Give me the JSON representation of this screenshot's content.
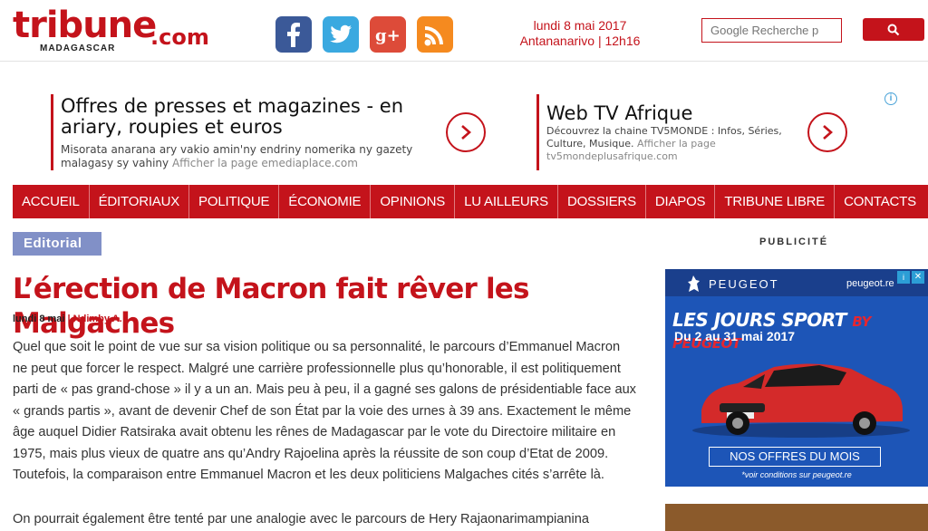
{
  "header": {
    "logo_main": "tribune",
    "logo_domain": ".com",
    "logo_country": "MADAGASCAR",
    "date": "lundi 8 mai 2017",
    "location_time": "Antananarivo | 12h16",
    "search_placeholder": "Google Recherche p",
    "social": [
      "facebook-icon",
      "twitter-icon",
      "google-plus-icon",
      "rss-icon"
    ],
    "accent": "#c4131b"
  },
  "ads": [
    {
      "title": "Offres de presses et magazines - en ariary, roupies et euros",
      "desc": "Misorata anarana ary vakio amin'ny endriny nomerika ny gazety malagasy sy vahiny",
      "link": "Afficher la page emediaplace.com"
    },
    {
      "title": "Web TV Afrique",
      "desc": "Découvrez la chaine TV5MONDE : Infos, Séries, Culture, Musique.",
      "link": "Afficher la page tv5mondeplusafrique.com"
    }
  ],
  "nav": [
    "ACCUEIL",
    "ÉDITORIAUX",
    "POLITIQUE",
    "ÉCONOMIE",
    "OPINIONS",
    "LU AILLEURS",
    "DOSSIERS",
    "DIAPOS",
    "TRIBUNE LIBRE",
    "CONTACTS"
  ],
  "article": {
    "category": "Editorial",
    "title": "L’érection de Macron fait rêver les Malgaches",
    "date": "lundi 8 mai",
    "author": "Ndimby A.",
    "paragraphs": [
      "Quel que soit le point de vue sur sa vision politique ou sa personnalité, le parcours d’Emmanuel Macron ne peut que forcer le respect. Malgré une carrière professionnelle plus qu’honorable, il est politiquement parti de « pas grand-chose » il y a un an. Mais peu à peu, il a gagné ses galons de présidentiable face aux « grands partis », avant de devenir Chef de son État par la voie des urnes à 39 ans. Exactement le même âge auquel Didier Ratsiraka avait obtenu les rênes de Madagascar par le vote du Directoire militaire en 1975, mais plus vieux de quatre ans qu’Andry Rajoelina après la réussite de son coup d’Etat de 2009. Toutefois, la comparaison entre Emmanuel Macron et les deux politiciens Malgaches cités s’arrête là.",
      "On pourrait également être tenté par une analogie avec le parcours de Hery Rajaonarimampianina"
    ]
  },
  "sidebar": {
    "label": "PUBLICITÉ",
    "ad": {
      "brand": "PEUGEOT",
      "url": "peugeot.re",
      "headline": "LES JOURS SPORT",
      "headline_by": "BY PEUGEOT",
      "dates": "Du 2 au 31 mai 2017",
      "cta": "NOS OFFRES DU MOIS",
      "note": "*voir conditions sur peugeot.re"
    }
  }
}
